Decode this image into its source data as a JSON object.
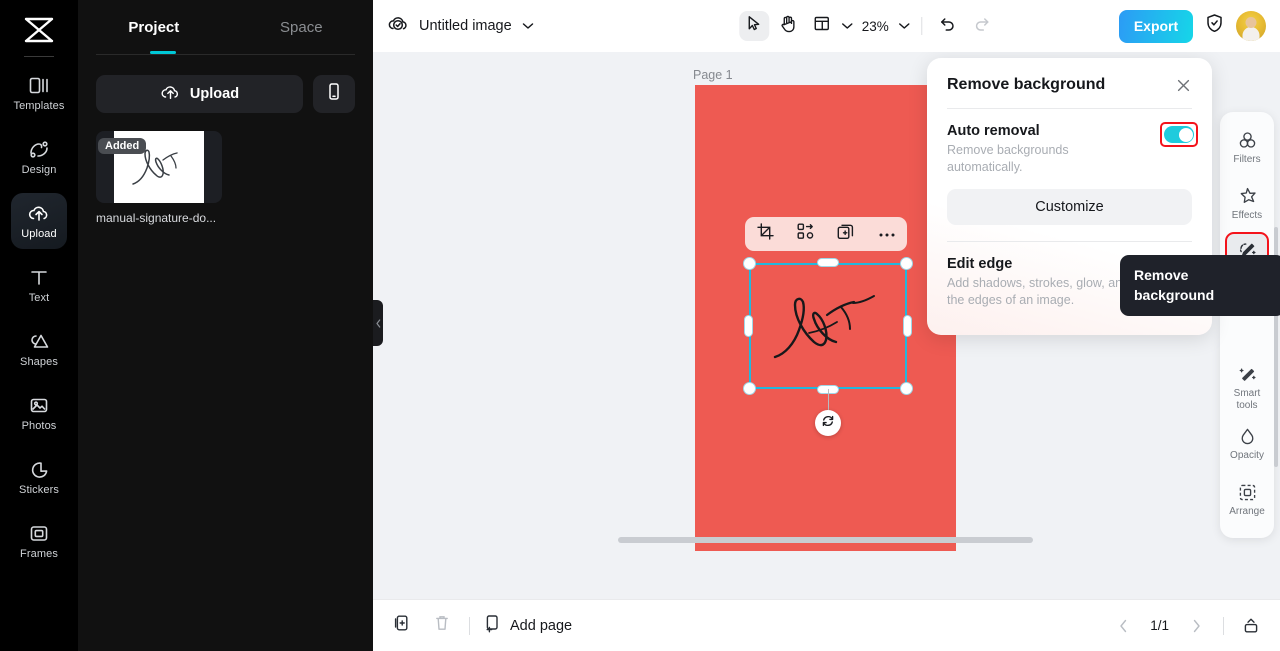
{
  "rail": {
    "logo_icon": "capcut-logo-icon",
    "items": [
      {
        "label": "Templates",
        "icon": "templates-icon",
        "active": false
      },
      {
        "label": "Design",
        "icon": "design-icon",
        "active": false
      },
      {
        "label": "Upload",
        "icon": "upload-cloud-icon",
        "active": true
      },
      {
        "label": "Text",
        "icon": "text-icon",
        "active": false
      },
      {
        "label": "Shapes",
        "icon": "shapes-icon",
        "active": false
      },
      {
        "label": "Photos",
        "icon": "photos-icon",
        "active": false
      },
      {
        "label": "Stickers",
        "icon": "stickers-icon",
        "active": false
      },
      {
        "label": "Frames",
        "icon": "frames-icon",
        "active": false
      }
    ]
  },
  "panel": {
    "tabs": [
      {
        "label": "Project",
        "active": true
      },
      {
        "label": "Space",
        "active": false
      }
    ],
    "upload_label": "Upload",
    "upload_icon": "upload-cloud-icon",
    "phone_icon": "mobile-phone-icon",
    "asset": {
      "badge": "Added",
      "name": "manual-signature-do...",
      "thumb_icon": "signature-thumbnail"
    }
  },
  "topbar": {
    "cloud_icon": "cloud-check-icon",
    "doc_title": "Untitled image",
    "title_chevron": "chevron-down-icon",
    "tools": [
      {
        "name": "select-tool",
        "icon": "cursor-arrow-icon",
        "selected": true
      },
      {
        "name": "hand-tool",
        "icon": "hand-icon",
        "selected": false
      },
      {
        "name": "layout-tool",
        "icon": "layout-grid-icon",
        "selected": false
      }
    ],
    "layout_chevron": "chevron-down-icon",
    "zoom_level": "23%",
    "zoom_chevron": "chevron-down-icon",
    "undo_icon": "undo-arrow-icon",
    "redo_icon": "redo-arrow-icon",
    "export_label": "Export",
    "shield_icon": "shield-check-icon",
    "avatar_name": "user-avatar"
  },
  "canvas": {
    "page_label": "Page 1",
    "artboard_color": "#ee5a52",
    "collapse_icon": "chevron-left-icon",
    "float_toolbar": [
      {
        "name": "crop-button",
        "icon": "crop-icon"
      },
      {
        "name": "replace-button",
        "icon": "replace-image-icon"
      },
      {
        "name": "duplicate-button",
        "icon": "duplicate-icon"
      },
      {
        "name": "more-button",
        "icon": "more-horizontal-icon"
      }
    ],
    "rotate_icon": "rotate-icon",
    "selection_color": "#22b8dd"
  },
  "remove_bg_panel": {
    "title": "Remove background",
    "close_icon": "close-x-icon",
    "auto_removal": {
      "heading": "Auto removal",
      "description": "Remove backgrounds automatically.",
      "toggle_on": true,
      "toggle_color": "#1fcbdd",
      "highlight_color": "#f4131b"
    },
    "customize_label": "Customize",
    "edit_edge": {
      "heading": "Edit edge",
      "description": "Add shadows, strokes, glow, and feathers to the edges of an image."
    }
  },
  "tooltip": {
    "text": "Remove background"
  },
  "right_sidebar": {
    "items": [
      {
        "label": "Filters",
        "icon": "filters-icon",
        "highlighted": false
      },
      {
        "label": "Effects",
        "icon": "effects-star-icon",
        "highlighted": false
      },
      {
        "label": "Remove backgr...",
        "icon": "remove-background-icon",
        "highlighted": true
      },
      {
        "label": "Smart tools",
        "icon": "smart-tools-wand-icon",
        "highlighted": false
      },
      {
        "label": "Opacity",
        "icon": "opacity-droplet-icon",
        "highlighted": false
      },
      {
        "label": "Arrange",
        "icon": "arrange-icon",
        "highlighted": false
      }
    ]
  },
  "bottombar": {
    "copy_icon": "copy-page-icon",
    "delete_icon": "trash-icon",
    "add_page_label": "Add page",
    "add_page_icon": "add-page-icon",
    "prev_icon": "chevron-left-icon",
    "page_indicator": "1/1",
    "next_icon": "chevron-right-icon",
    "expand_icon": "expand-panel-icon"
  }
}
